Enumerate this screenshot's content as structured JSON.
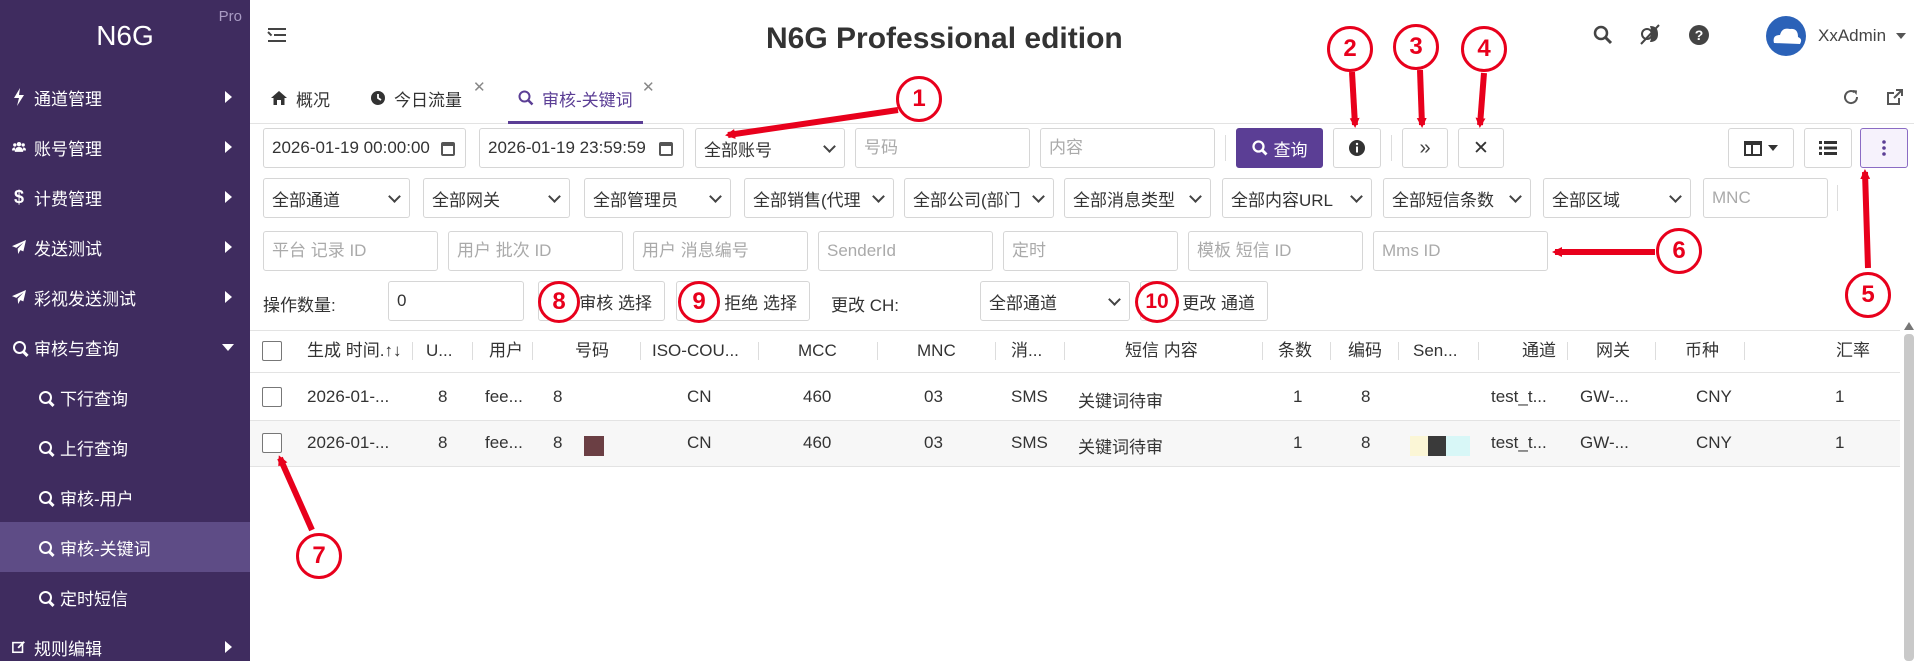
{
  "sidebar": {
    "brand": "N6G",
    "badge": "Pro",
    "items": [
      {
        "label": "通道管理"
      },
      {
        "label": "账号管理"
      },
      {
        "label": "计费管理"
      },
      {
        "label": "发送测试"
      },
      {
        "label": "彩视发送测试"
      },
      {
        "label": "审核与查询"
      },
      {
        "label": "下行查询"
      },
      {
        "label": "上行查询"
      },
      {
        "label": "审核-用户"
      },
      {
        "label": "审核-关键词"
      },
      {
        "label": "定时短信"
      },
      {
        "label": "规则编辑"
      }
    ]
  },
  "header": {
    "title": "N6G Professional edition",
    "user": "XxAdmin"
  },
  "tabs": [
    {
      "label": "概况"
    },
    {
      "label": "今日流量"
    },
    {
      "label": "审核-关键词"
    }
  ],
  "filters": {
    "start_time": "2026-01-19 00:00:00",
    "end_time": "2026-01-19 23:59:59",
    "account": "全部账号",
    "number_placeholder": "号码",
    "content_placeholder": "内容",
    "query_label": "查询",
    "row2": [
      "全部通道",
      "全部网关",
      "全部管理员",
      "全部销售(代理",
      "全部公司(部门",
      "全部消息类型",
      "全部内容URL",
      "全部短信条数",
      "全部区域"
    ],
    "mnc_placeholder": "MNC",
    "row3": [
      "平台 记录 ID",
      "用户 批次 ID",
      "用户 消息编号",
      "SenderId",
      "定时",
      "模板 短信 ID",
      "Mms ID"
    ]
  },
  "actions": {
    "count_label": "操作数量:",
    "count_value": "0",
    "approve_label": "审核 选择",
    "reject_label": "拒绝 选择",
    "change_ch_label": "更改 CH:",
    "channel_select": "全部通道",
    "change_channel_label": "更改 通道"
  },
  "table": {
    "headers": [
      "生成 时间.↑↓",
      "U...",
      "用户",
      "号码",
      "ISO-COU...",
      "MCC",
      "MNC",
      "消...",
      "短信 内容",
      "条数",
      "编码",
      "Sen...",
      "通道",
      "网关",
      "币种",
      "汇率"
    ],
    "rows": [
      [
        "2026-01-...",
        "8",
        "fee...",
        "8",
        "CN",
        "460",
        "03",
        "SMS",
        "关键词待审",
        "1",
        "8",
        "test_t...",
        "GW-...",
        "CNY",
        "1"
      ],
      [
        "2026-01-...",
        "8",
        "fee...",
        "8",
        "CN",
        "460",
        "03",
        "SMS",
        "关键词待审",
        "1",
        "8",
        "test_t...",
        "GW-...",
        "CNY",
        "1"
      ]
    ]
  },
  "annotations": [
    "1",
    "2",
    "3",
    "4",
    "5",
    "6",
    "7",
    "8",
    "9",
    "10"
  ],
  "colors": {
    "sidebar": "#3f2c5f",
    "sidebar_active": "#5e4c86",
    "primary": "#5b3e95",
    "annotation": "#e8001c"
  }
}
